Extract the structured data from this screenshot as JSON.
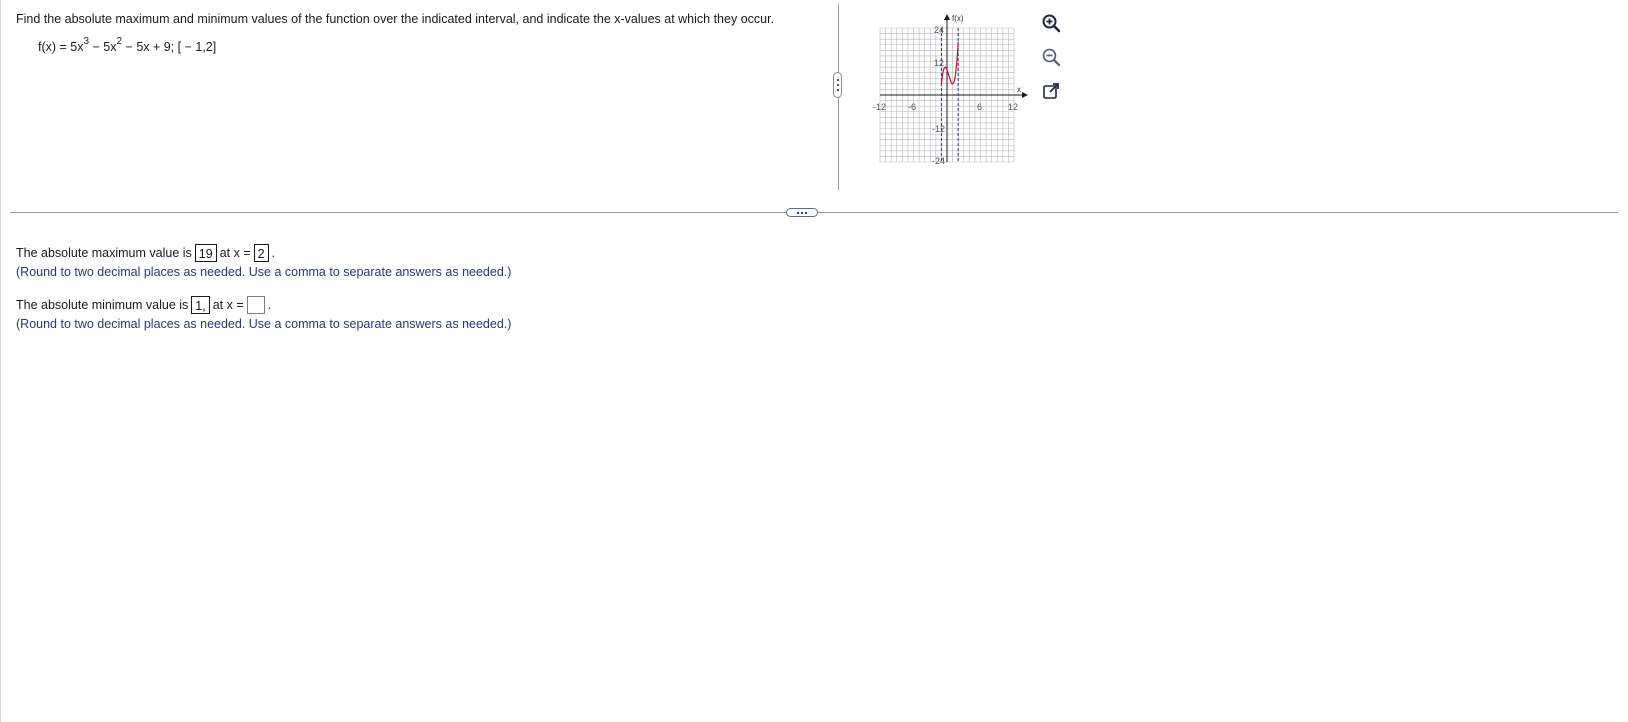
{
  "question": {
    "prompt": "Find the absolute maximum and minimum values of the function over the indicated interval, and indicate the x-values at which they occur.",
    "func_prefix": "f(x) = 5x",
    "exp1": "3",
    "func_mid": " − 5x",
    "exp2": "2",
    "func_suffix": " − 5x + 9; [ − 1,2]"
  },
  "graph": {
    "y_axis_label": "f(x)",
    "x_axis_label": "x",
    "x_ticks": [
      "-12",
      "-6",
      "6",
      "12"
    ],
    "y_ticks": [
      "24",
      "12",
      "-12",
      "-24"
    ],
    "curve_color": "#c8102e",
    "axis_color": "#1a1a1a",
    "dashed_color": "#1f2f9a"
  },
  "tools": {
    "zoom_in": "zoom-in-icon",
    "zoom_out": "zoom-out-icon",
    "popout": "popout-icon"
  },
  "answer": {
    "max_prefix": "The absolute maximum value is",
    "max_value": "19",
    "at_x": "at x =",
    "max_x": "2",
    "period": ".",
    "hint": "(Round to two decimal places as needed. Use a comma to separate answers as needed.)",
    "min_prefix": "The absolute minimum value is",
    "min_value": "1,",
    "min_x": ""
  }
}
